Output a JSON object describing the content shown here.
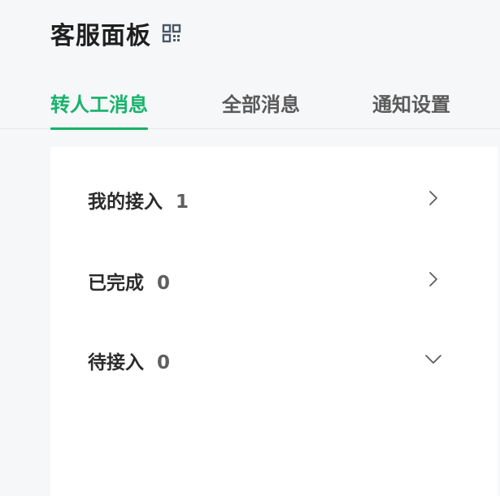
{
  "header": {
    "title": "客服面板",
    "qr_icon": "qrcode-icon"
  },
  "tabs": [
    {
      "label": "转人工消息",
      "active": true
    },
    {
      "label": "全部消息",
      "active": false
    },
    {
      "label": "通知设置",
      "active": false
    }
  ],
  "queue": [
    {
      "label": "我的接入",
      "count": "1",
      "icon": "chevron-right-icon"
    },
    {
      "label": "已完成",
      "count": "0",
      "icon": "chevron-right-icon"
    },
    {
      "label": "待接入",
      "count": "0",
      "icon": "chevron-down-icon"
    }
  ],
  "colors": {
    "accent": "#17b26a",
    "background": "#f6f7f9",
    "panel": "#ffffff",
    "text": "#1f1f1f"
  }
}
